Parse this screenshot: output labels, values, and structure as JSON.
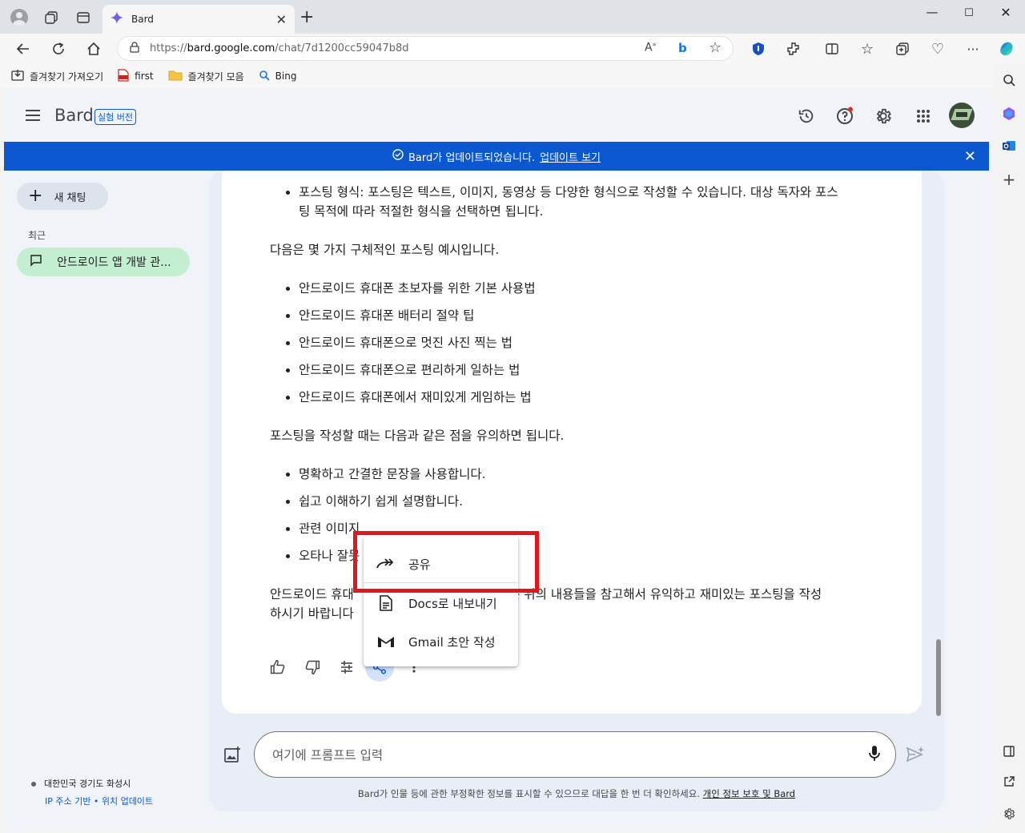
{
  "browser": {
    "tab_title": "Bard",
    "url_prefix": "https://",
    "url_host": "bard.google.com",
    "url_path": "/chat/7d1200cc59047b8d",
    "favorites": [
      {
        "label": "즐겨찾기 가져오기",
        "icon": "import-icon"
      },
      {
        "label": "first",
        "icon": "pdf-icon"
      },
      {
        "label": "즐겨찾기 모음",
        "icon": "folder-icon"
      },
      {
        "label": "Bing",
        "icon": "search-icon"
      }
    ]
  },
  "header": {
    "title": "Bard",
    "badge": "실험 버전"
  },
  "banner": {
    "message": "Bard가 업데이트되었습니다.",
    "link": "업데이트 보기"
  },
  "sidebar": {
    "new_chat": "새 채팅",
    "recent_label": "최근",
    "recent_items": [
      "안드로이드 앱 개발 관..."
    ],
    "location": "대한민국 경기도 화성시",
    "location_links": "IP 주소 기반 • 위치 업데이트"
  },
  "response": {
    "bullet_top_line1": "포스팅 형식: 포스팅은 텍스트, 이미지, 동영상 등 다양한 형식으로 작성할 수 있습니다. 대상 독자와 포스",
    "bullet_top_line2": "팅 목적에 따라 적절한 형식을 선택하면 됩니다.",
    "para1": "다음은 몇 가지 구체적인 포스팅 예시입니다.",
    "examples": [
      "안드로이드 휴대폰 초보자를 위한 기본 사용법",
      "안드로이드 휴대폰 배터리 절약 팁",
      "안드로이드 휴대폰으로 멋진 사진 찍는 법",
      "안드로이드 휴대폰으로 편리하게 일하는 법",
      "안드로이드 휴대폰에서 재미있게 게임하는 법"
    ],
    "para2": "포스팅을 작성할 때는 다음과 같은 점을 유의하면 됩니다.",
    "tips": [
      "명확하고 간결한 문장을 사용합니다.",
      "쉽고 이해하기 쉽게 설명합니다.",
      "관련 이미지",
      "오타나 잘못"
    ],
    "closing_line1_a": "안드로이드 휴대",
    "closing_line1_b": "할 때는 위의 내용들을 참고해서 유익하고 재미있는 포스팅을 작성",
    "closing_line2": "하시기 바랍니다"
  },
  "share_menu": {
    "items": [
      {
        "label": "공유",
        "icon": "share-arrow-icon"
      },
      {
        "label": "Docs로 내보내기",
        "icon": "docs-icon"
      },
      {
        "label": "Gmail 초안 작성",
        "icon": "gmail-icon"
      }
    ]
  },
  "input": {
    "placeholder": "여기에 프롬프트 입력"
  },
  "disclaimer": {
    "text": "Bard가 인물 등에 관한 부정확한 정보를 표시할 수 있으므로 대답을 한 번 더 확인하세요. ",
    "link": "개인 정보 보호 및 Bard"
  },
  "colors": {
    "accent": "#0b57d0",
    "recent_highlight": "#c4eed0",
    "annotation_red": "#e8141b"
  }
}
